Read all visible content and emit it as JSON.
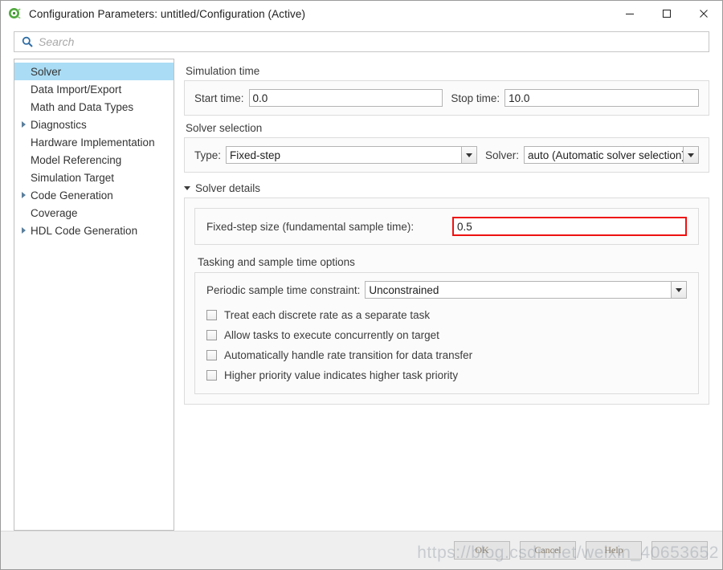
{
  "window": {
    "title": "Configuration Parameters: untitled/Configuration (Active)",
    "app_icon": "simulink-icon",
    "controls": {
      "minimize": "minimize-icon",
      "maximize": "maximize-icon",
      "close": "close-icon"
    }
  },
  "search": {
    "icon": "search-icon",
    "placeholder": "Search",
    "value": ""
  },
  "tree": {
    "items": [
      {
        "label": "Solver",
        "expandable": false,
        "selected": true
      },
      {
        "label": "Data Import/Export",
        "expandable": false,
        "selected": false
      },
      {
        "label": "Math and Data Types",
        "expandable": false,
        "selected": false
      },
      {
        "label": "Diagnostics",
        "expandable": true,
        "selected": false
      },
      {
        "label": "Hardware Implementation",
        "expandable": false,
        "selected": false
      },
      {
        "label": "Model Referencing",
        "expandable": false,
        "selected": false
      },
      {
        "label": "Simulation Target",
        "expandable": false,
        "selected": false
      },
      {
        "label": "Code Generation",
        "expandable": true,
        "selected": false
      },
      {
        "label": "Coverage",
        "expandable": false,
        "selected": false
      },
      {
        "label": "HDL Code Generation",
        "expandable": true,
        "selected": false
      }
    ]
  },
  "simulation_time": {
    "group_title": "Simulation time",
    "start_time_label": "Start time:",
    "start_time_value": "0.0",
    "stop_time_label": "Stop time:",
    "stop_time_value": "10.0"
  },
  "solver_selection": {
    "group_title": "Solver selection",
    "type_label": "Type:",
    "type_value": "Fixed-step",
    "solver_label": "Solver:",
    "solver_value": "auto (Automatic solver selection)"
  },
  "solver_details": {
    "disclosure_label": "Solver details",
    "expanded": true,
    "fixed_step_label": "Fixed-step size (fundamental sample time):",
    "fixed_step_value": "0.5",
    "highlight_color": "#ee1111",
    "tasking_title": "Tasking and sample time options",
    "periodic_label": "Periodic sample time constraint:",
    "periodic_value": "Unconstrained",
    "checkboxes": [
      {
        "label": "Treat each discrete rate as a separate task",
        "checked": false
      },
      {
        "label": "Allow tasks to execute concurrently on target",
        "checked": false
      },
      {
        "label": "Automatically handle rate transition for data transfer",
        "checked": false
      },
      {
        "label": "Higher priority value indicates higher task priority",
        "checked": false
      }
    ]
  },
  "footer": {
    "ok_label": "OK",
    "cancel_label": "Cancel",
    "help_label": "Help",
    "apply_label": ""
  },
  "watermark": {
    "text": "https://blog.csdn.net/weixin_40653652"
  }
}
